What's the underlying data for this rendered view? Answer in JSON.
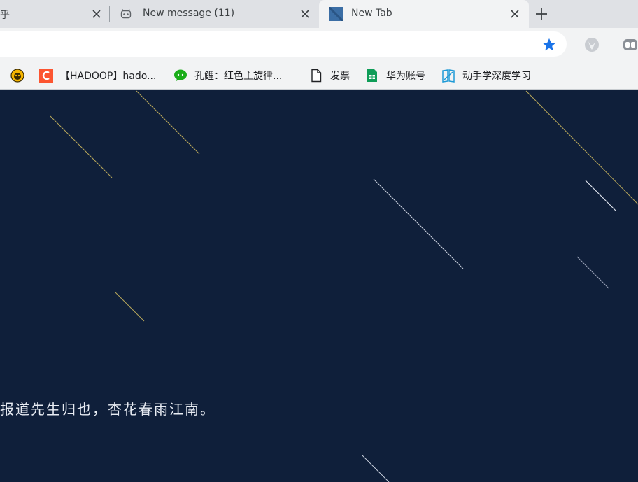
{
  "tabs": [
    {
      "title": "乎",
      "close_symbol": "×"
    },
    {
      "title": "New message (11)",
      "close_symbol": "×",
      "favicon": "robot-icon"
    },
    {
      "title": "New Tab",
      "close_symbol": "×",
      "favicon": "newtab-icon",
      "active": true
    }
  ],
  "new_tab_symbol": "+",
  "toolbar": {
    "bookmark_star_color": "#1a73e8"
  },
  "bookmarks": [
    {
      "label": "",
      "icon": "monkey-icon"
    },
    {
      "label": "【HADOOP】hado...",
      "icon": "csdn-icon"
    },
    {
      "label": "孔鲤：红色主旋律...",
      "icon": "wechat-icon"
    },
    {
      "label": "发票",
      "icon": "document-icon"
    },
    {
      "label": "华为账号",
      "icon": "sheet-icon"
    },
    {
      "label": "动手学深度学习",
      "icon": "book-icon"
    }
  ],
  "content": {
    "background": "#0f1f3a",
    "poem": "报道先生归也，杏花春雨江南。"
  }
}
